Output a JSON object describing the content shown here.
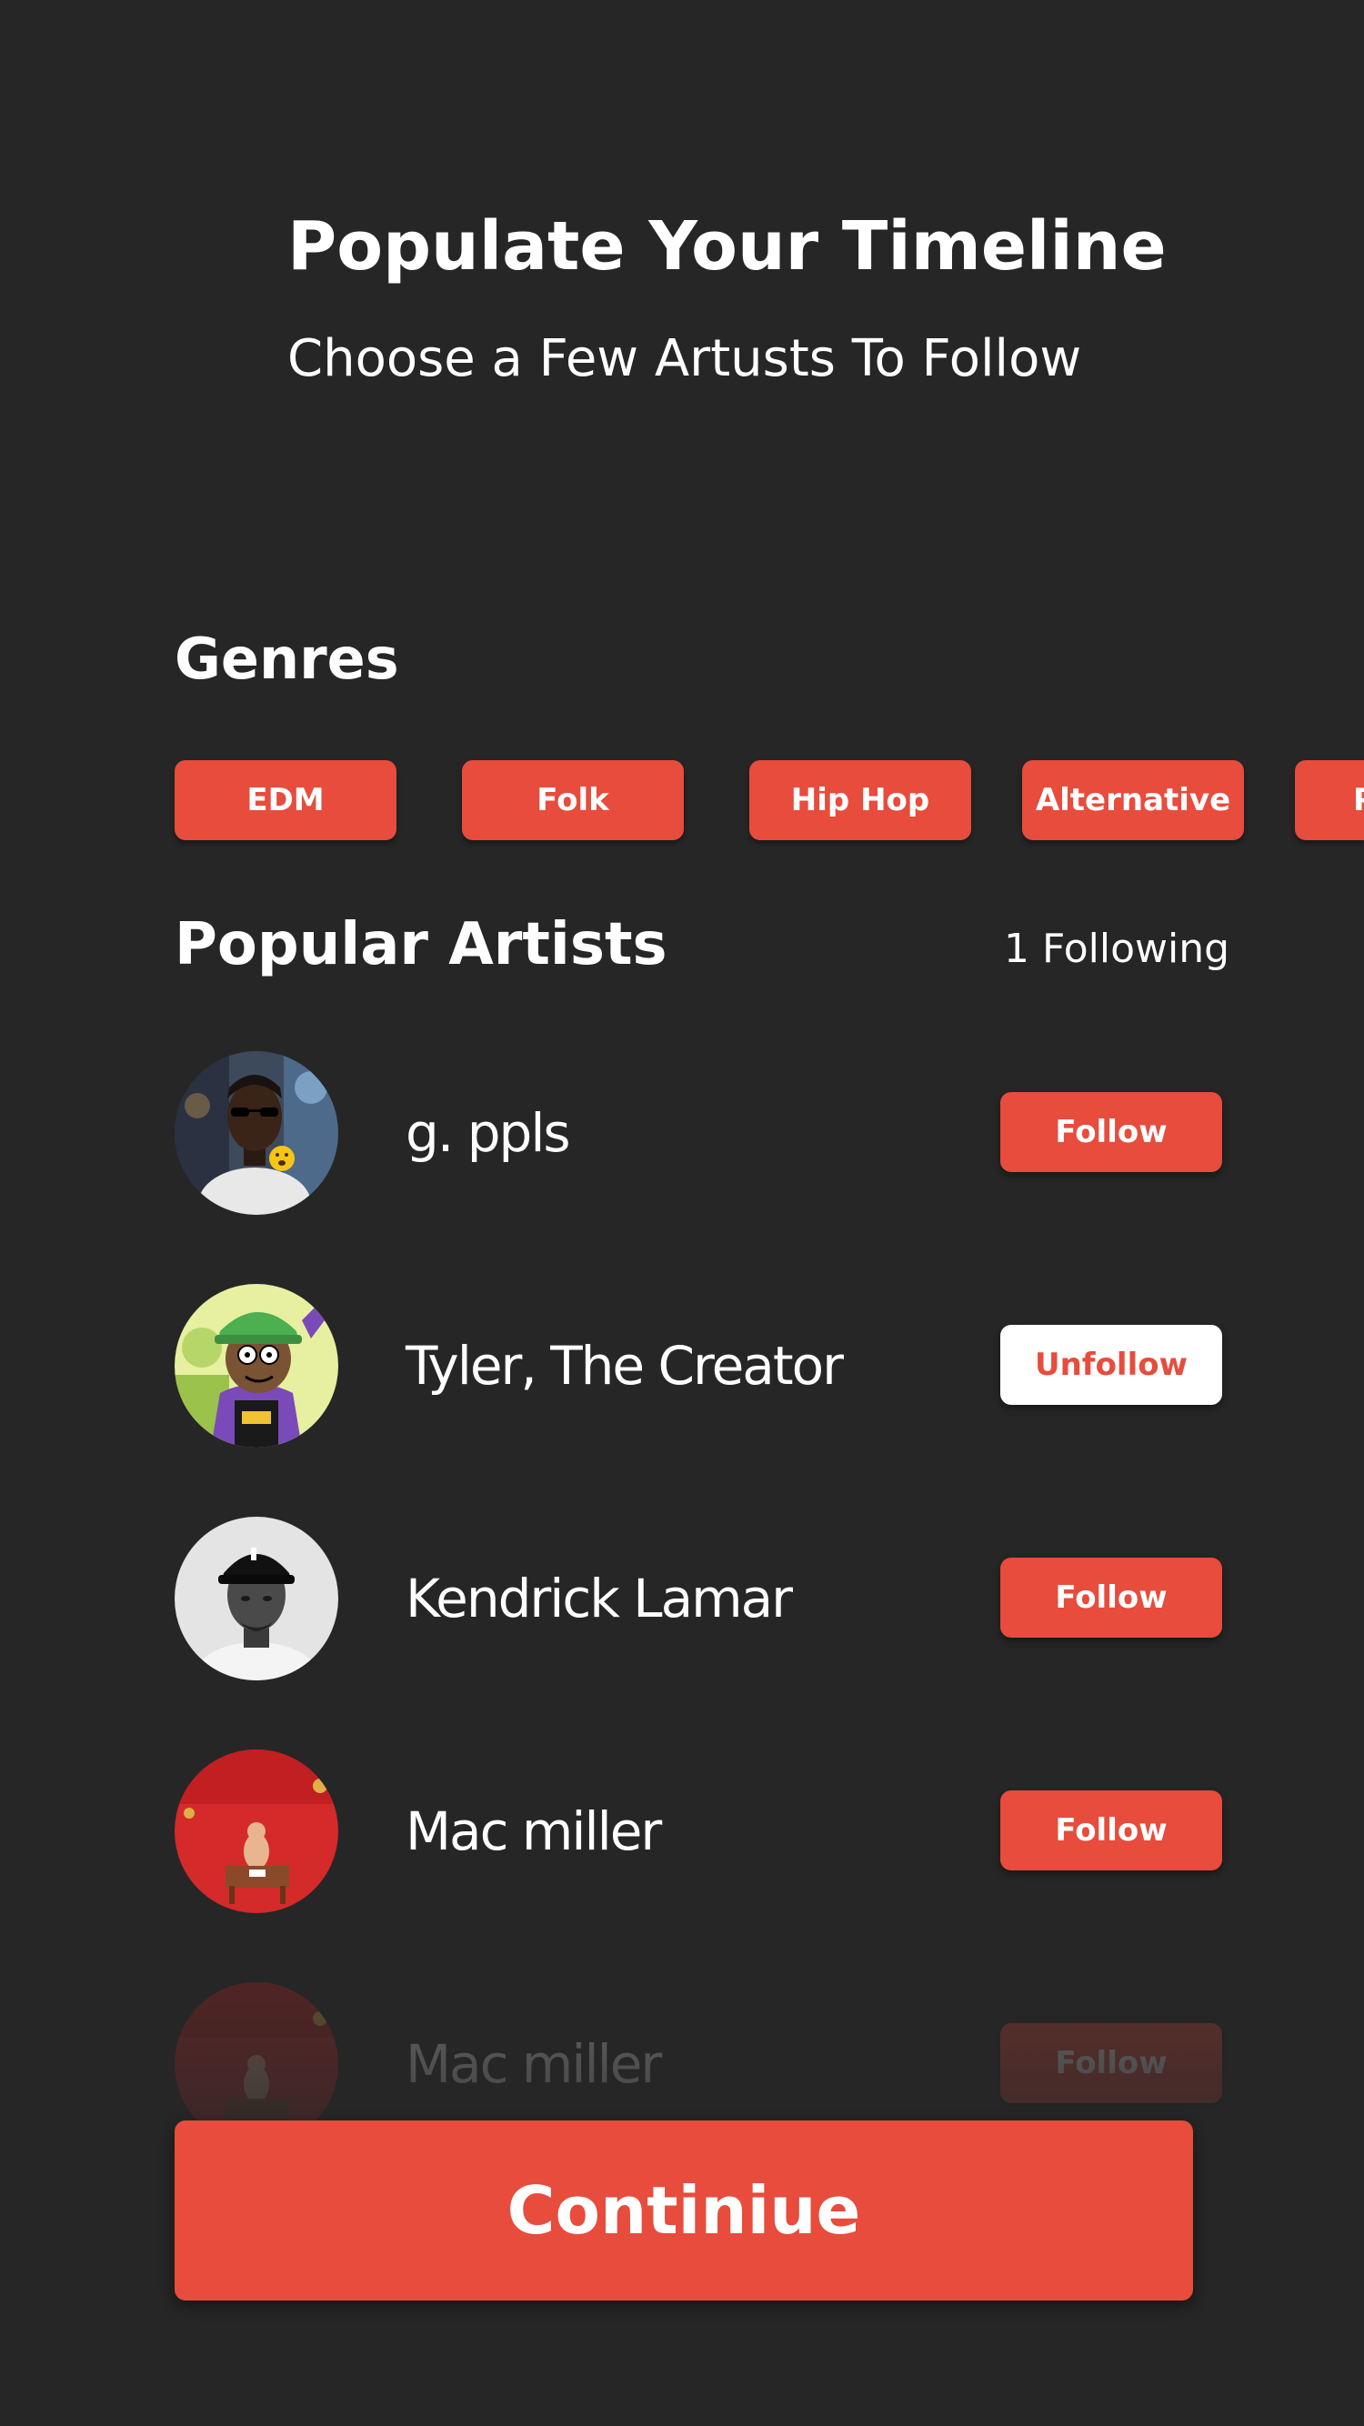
{
  "header": {
    "title": "Populate Your Timeline",
    "subtitle": "Choose a Few Artusts To Follow"
  },
  "genres": {
    "heading": "Genres",
    "items": [
      {
        "label": "EDM"
      },
      {
        "label": "Folk"
      },
      {
        "label": "Hip Hop"
      },
      {
        "label": "Alternative"
      },
      {
        "label": "P"
      }
    ]
  },
  "popular": {
    "heading": "Popular Artists",
    "following_count": "1 Following",
    "artists": [
      {
        "name": "g. ppls",
        "button": "Follow",
        "following": false,
        "avatar": "person-with-sunglasses-photo"
      },
      {
        "name": "Tyler, The Creator",
        "button": "Unfollow",
        "following": true,
        "avatar": "cartoon-character-green-cap"
      },
      {
        "name": "Kendrick Lamar",
        "button": "Follow",
        "following": false,
        "avatar": "black-and-white-portrait-cap"
      },
      {
        "name": "Mac miller",
        "button": "Follow",
        "following": false,
        "avatar": "red-album-cover"
      },
      {
        "name": "Mac miller",
        "button": "Follow",
        "following": false,
        "avatar": "red-album-cover"
      }
    ]
  },
  "footer": {
    "continue_label": "Continiue"
  },
  "colors": {
    "background": "#262626",
    "accent": "#e74c3c",
    "text": "#ffffff"
  }
}
